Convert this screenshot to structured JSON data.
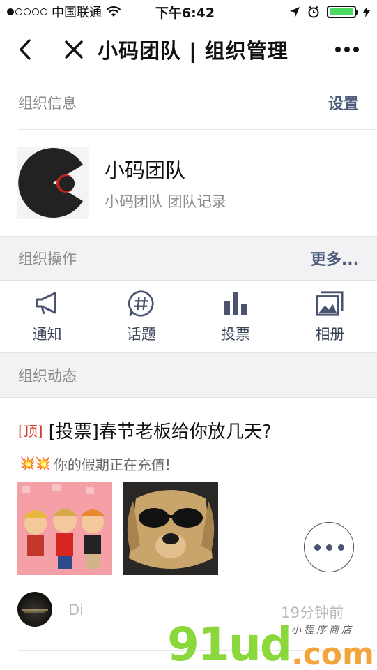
{
  "status_bar": {
    "carrier": "中国联通",
    "time": "下午6:42"
  },
  "nav": {
    "title": "小码团队 | 组织管理"
  },
  "org_info": {
    "section_title": "组织信息",
    "action": "设置",
    "name": "小码团队",
    "subtitle": "小码团队 团队记录"
  },
  "org_ops": {
    "section_title": "组织操作",
    "action": "更多...",
    "items": [
      {
        "label": "通知",
        "icon": "megaphone-icon"
      },
      {
        "label": "话题",
        "icon": "hashtag-bubble-icon"
      },
      {
        "label": "投票",
        "icon": "bar-chart-icon"
      },
      {
        "label": "相册",
        "icon": "album-icon"
      }
    ]
  },
  "feed": {
    "section_title": "组织动态",
    "post": {
      "pin_tag": "[顶]",
      "title": "[投票]春节老板给你放几天?",
      "emoji": "💥💥",
      "subtitle": "你的假期正在充值!",
      "author": "Di",
      "time": "19分钟前"
    }
  },
  "watermark": {
    "brand": "91ud",
    "tld": ".com",
    "tagline": "小程序商店"
  },
  "colors": {
    "accent": "#4a5a78",
    "pin": "#d43b2e",
    "battery": "#4cd964"
  }
}
